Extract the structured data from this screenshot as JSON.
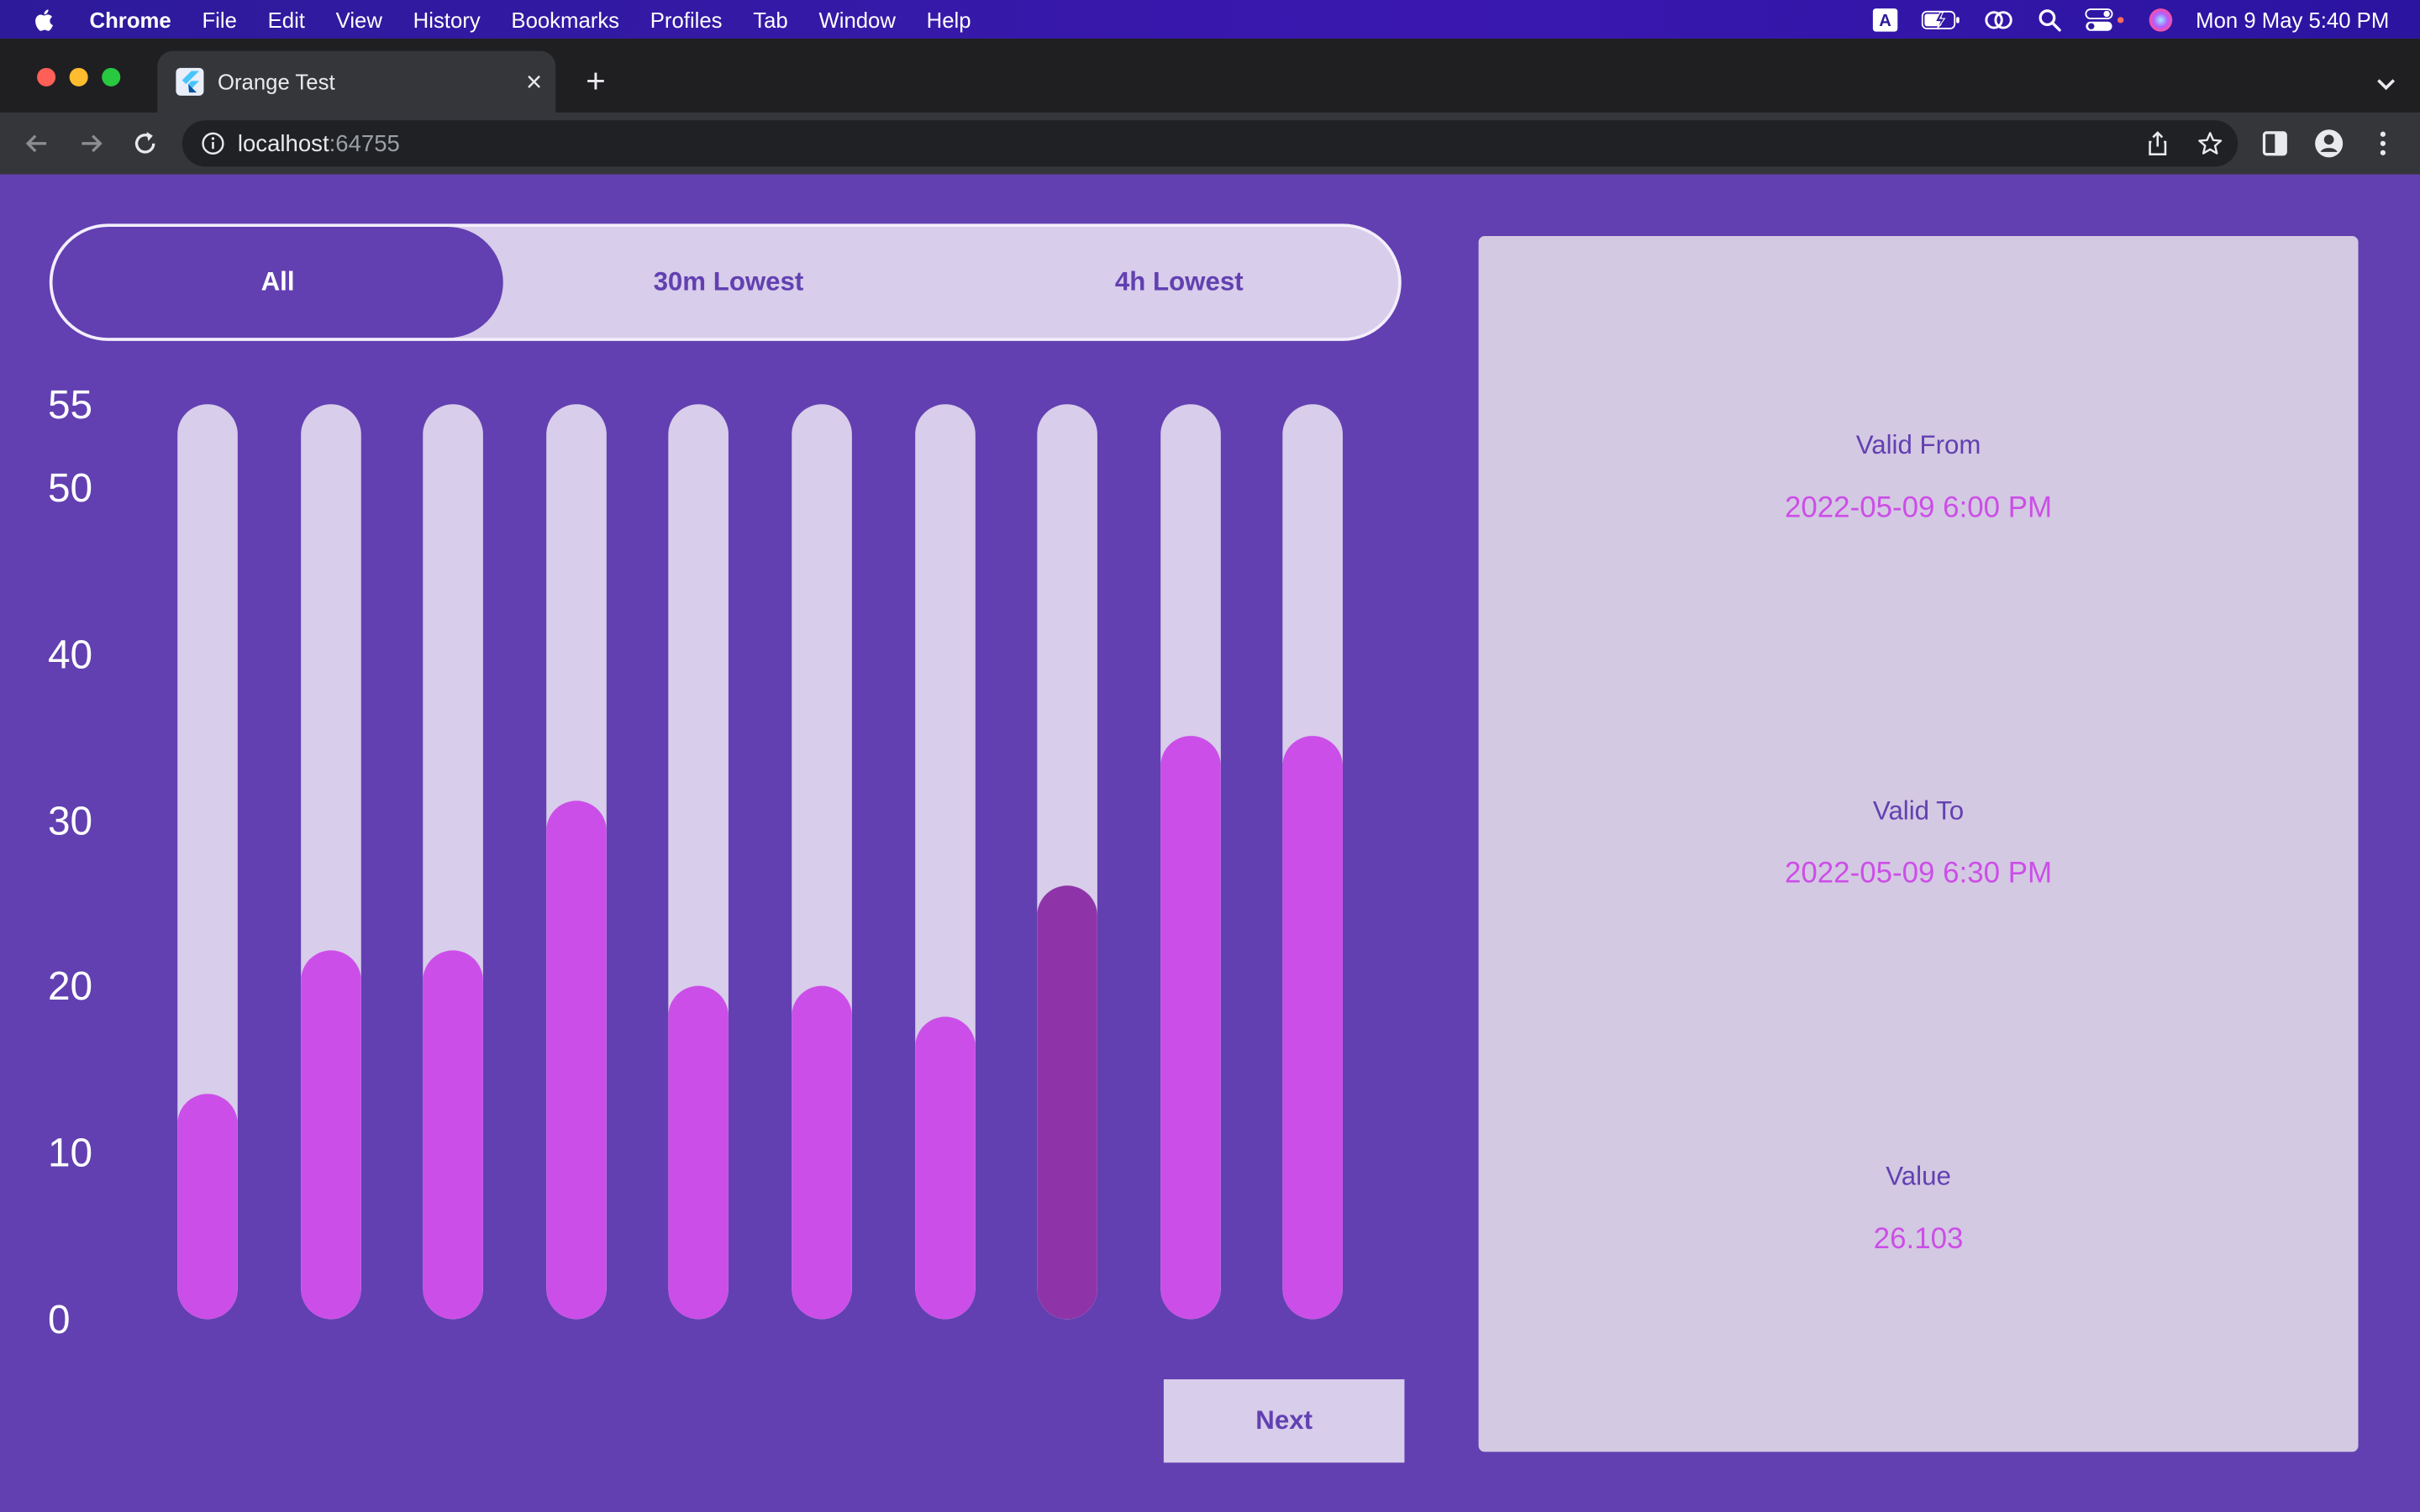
{
  "menubar": {
    "app_name": "Chrome",
    "items": [
      "File",
      "Edit",
      "View",
      "History",
      "Bookmarks",
      "Profiles",
      "Tab",
      "Window",
      "Help"
    ],
    "clock": "Mon 9 May  5:40 PM",
    "icons": [
      "input-source-icon",
      "battery-icon",
      "screen-mirror-icon",
      "spotlight-icon",
      "control-center-icon",
      "siri-icon"
    ]
  },
  "browser": {
    "tab_title": "Orange Test",
    "url_host": "localhost",
    "url_port": ":64755"
  },
  "segments": [
    {
      "label": "All",
      "active": true
    },
    {
      "label": "30m Lowest",
      "active": false
    },
    {
      "label": "4h Lowest",
      "active": false
    }
  ],
  "next_label": "Next",
  "details": {
    "valid_from_label": "Valid From",
    "valid_from_value": "2022-05-09 6:00 PM",
    "valid_to_label": "Valid To",
    "valid_to_value": "2022-05-09 6:30 PM",
    "value_label": "Value",
    "value_value": "26.103"
  },
  "colors": {
    "background": "#6240b1",
    "track": "#d8cdea",
    "bar": "#cc4ee8",
    "bar_selected": "#8f34a8",
    "card": "#d4c9e2",
    "value_text": "#cc4ee8"
  },
  "chart_data": {
    "type": "bar",
    "yticks": [
      "0",
      "10",
      "20",
      "30",
      "40",
      "50",
      "55"
    ],
    "ylim": [
      0,
      55
    ],
    "values": [
      13.5,
      22.2,
      22.2,
      31.2,
      20,
      20,
      18.2,
      26.103,
      35.1,
      35.1
    ],
    "selected_index": 7,
    "grid": false
  }
}
